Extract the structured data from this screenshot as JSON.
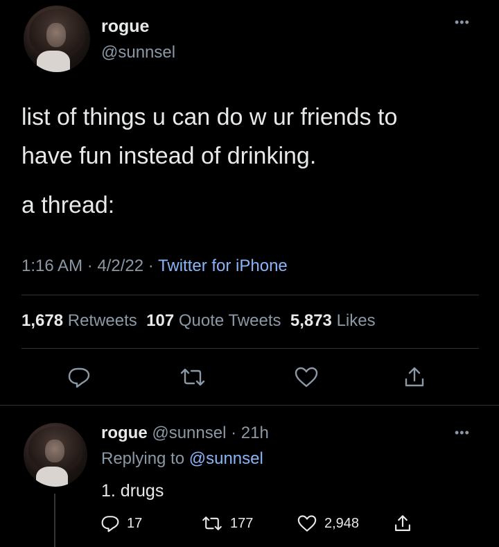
{
  "main_tweet": {
    "author_name": "rogue",
    "author_handle": "@sunnsel",
    "more_icon": "more-dots-icon",
    "text_line1": "list of things u can do w ur friends to",
    "text_line2": "have fun instead of drinking.",
    "text_line3": "a thread:",
    "time": "1:16 AM",
    "date": "4/2/22",
    "source": "Twitter for iPhone",
    "retweets_count": "1,678",
    "retweets_label": "Retweets",
    "quotes_count": "107",
    "quotes_label": "Quote Tweets",
    "likes_count": "5,873",
    "likes_label": "Likes",
    "actions": [
      "reply-icon",
      "retweet-icon",
      "like-icon",
      "share-icon"
    ]
  },
  "reply_tweet": {
    "author_name": "rogue",
    "author_handle": "@sunnsel",
    "age": "21h",
    "replying_prefix": "Replying to",
    "replying_handle": "@sunnsel",
    "text": "1. drugs",
    "reply_count": "17",
    "retweet_count": "177",
    "like_count": "2,948"
  },
  "colors": {
    "background": "#000000",
    "text": "#e7e9ea",
    "secondary": "#8b98a5",
    "link": "#8ab4f8",
    "divider": "#2f3336"
  }
}
